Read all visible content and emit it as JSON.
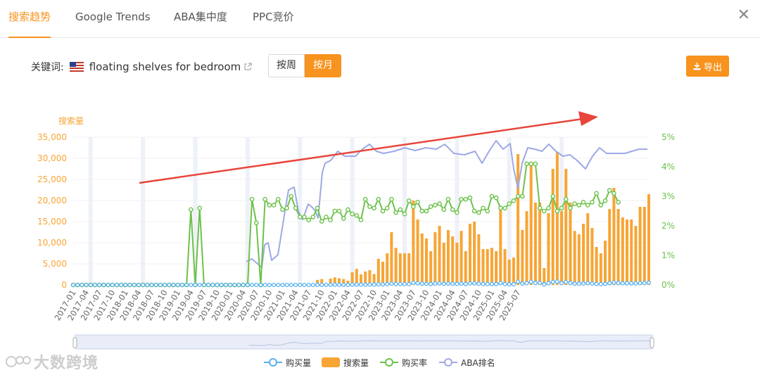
{
  "tabs": [
    {
      "label": "搜索趋势",
      "active": true
    },
    {
      "label": "Google Trends",
      "active": false
    },
    {
      "label": "ABA集中度",
      "active": false
    },
    {
      "label": "PPC竞价",
      "active": false
    }
  ],
  "close_label": "✕",
  "keyword": {
    "label": "关键词:",
    "flag": "us-flag-icon",
    "text": "floating shelves for bedroom"
  },
  "period_toggle": {
    "options": [
      "按周",
      "按月"
    ],
    "selected": "按月"
  },
  "export_label": "导出",
  "watermark": "大数跨境",
  "colors": {
    "accent": "#f7931e",
    "search_volume": "#f7a535",
    "purchase_volume": "#5ab1ef",
    "purchase_rate": "#6cc24a",
    "aba_rank": "#9fa8e6",
    "arrow": "#e8453c"
  },
  "chart_data": {
    "type": "bar",
    "title": "",
    "ylabel_left": "搜索量",
    "y_left_ticks": [
      "0",
      "5,000",
      "10,000",
      "15,000",
      "20,000",
      "25,000",
      "30,000",
      "35,000"
    ],
    "y_left_range": [
      0,
      35000
    ],
    "y_right_ticks": [
      "0%",
      "1%",
      "2%",
      "3%",
      "4%",
      "5%"
    ],
    "y_right_range": [
      0,
      5
    ],
    "x_labels": [
      "2017-01",
      "2017-04",
      "2017-07",
      "2017-10",
      "2018-01",
      "2018-04",
      "2018-07",
      "2018-10",
      "2019-01",
      "2019-04",
      "2019-07",
      "2019-10",
      "2020-01",
      "2020-04",
      "2020-07",
      "2020-10",
      "2021-01",
      "2021-04",
      "2021-07",
      "2021-10",
      "2022-01",
      "2022-04",
      "2022-07",
      "2022-10",
      "2023-01",
      "2023-04",
      "2023-07",
      "2023-10",
      "2024-01",
      "2024-04",
      "2024-07",
      "2024-10",
      "2025-01",
      "2025-04",
      "2025-07"
    ],
    "legend": [
      "购买量",
      "搜索量",
      "购买率",
      "ABA排名"
    ],
    "legend_position": "bottom",
    "search_volume": [
      0,
      0,
      0,
      0,
      0,
      0,
      0,
      0,
      0,
      0,
      0,
      0,
      0,
      0,
      0,
      0,
      0,
      0,
      0,
      0,
      0,
      0,
      0,
      0,
      0,
      0,
      0,
      0,
      0,
      0,
      0,
      0,
      0,
      0,
      0,
      0,
      0,
      0,
      0,
      0,
      0,
      0,
      0,
      0,
      0,
      0,
      0,
      0,
      0,
      0,
      0,
      0,
      0,
      0,
      0,
      0,
      1200,
      1400,
      0,
      1500,
      1800,
      1600,
      1400,
      1000,
      3000,
      3800,
      2500,
      3200,
      3500,
      2600,
      6200,
      5500,
      7500,
      12500,
      8800,
      7500,
      7500,
      7500,
      20000,
      15500,
      12200,
      11000,
      8000,
      12500,
      14000,
      10000,
      13000,
      11500,
      10000,
      12800,
      8000,
      14500,
      15000,
      12000,
      8500,
      8500,
      8800,
      8000,
      18000,
      8500,
      6000,
      6500,
      31000,
      13000,
      17500,
      29000,
      19500,
      19500,
      4000,
      17000,
      27500,
      31500,
      17500,
      27500,
      19500,
      12800,
      12000,
      14500,
      17000,
      13500,
      9000,
      7500,
      10500,
      18000,
      23000,
      18000,
      16000,
      15500,
      15500,
      14000,
      18500,
      18500,
      21500
    ],
    "purchase_rate": [
      0,
      0,
      0,
      0,
      0,
      0,
      0,
      0,
      0,
      0,
      0,
      0,
      0,
      0,
      0,
      0,
      0,
      0,
      0,
      0,
      0,
      0,
      0,
      0,
      0,
      0,
      0,
      2.55,
      0,
      2.6,
      0,
      0,
      0,
      0,
      0,
      0,
      0,
      0,
      0,
      0,
      0,
      2.9,
      2.1,
      0,
      2.9,
      2.7,
      2.7,
      2.9,
      2.55,
      2.6,
      3.0,
      2.6,
      2.3,
      2.3,
      2.2,
      2.3,
      2.6,
      2.15,
      2.3,
      2.2,
      2.5,
      2.5,
      2.25,
      2.55,
      2.4,
      2.35,
      2.2,
      2.9,
      2.65,
      2.6,
      2.9,
      2.5,
      2.6,
      2.9,
      2.45,
      2.55,
      2.4,
      2.85,
      2.65,
      2.8,
      2.5,
      2.5,
      2.65,
      2.7,
      2.75,
      2.55,
      2.9,
      2.55,
      2.45,
      2.9,
      2.9,
      2.95,
      2.5,
      2.45,
      2.6,
      2.5,
      3.0,
      2.95,
      2.6,
      2.6,
      2.75,
      2.85,
      3.0,
      3.0,
      4.1,
      4.1,
      4.1,
      2.6,
      2.5,
      2.6,
      3.0,
      2.5,
      2.6,
      2.9,
      2.6,
      2.75,
      2.7,
      2.8,
      2.7,
      2.8,
      3.1,
      2.7,
      2.85,
      3.2,
      3.1,
      2.8
    ],
    "aba_rank_note": "curve shown without right-axis scale",
    "annotation": "trend arrow"
  }
}
